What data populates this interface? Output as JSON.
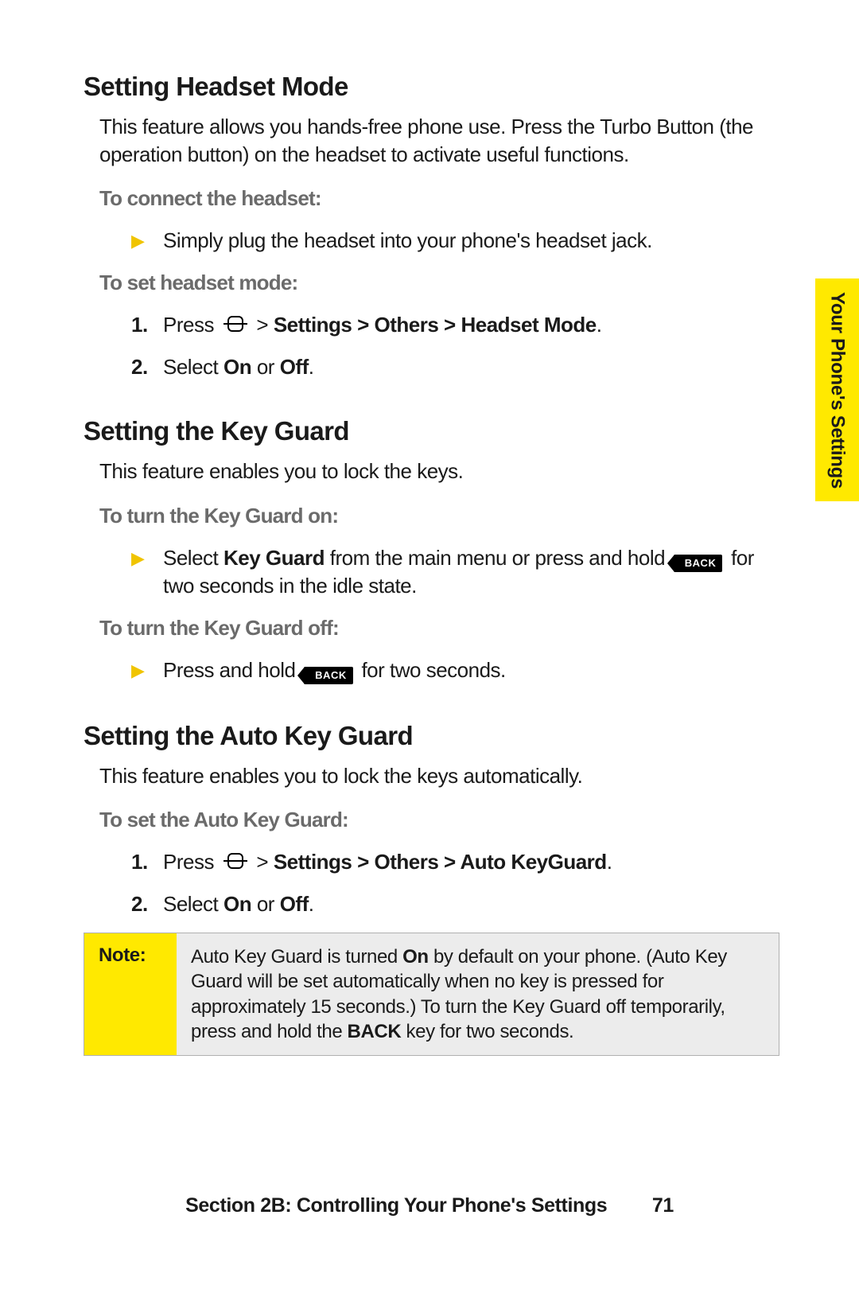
{
  "sidetab": "Your Phone's Settings",
  "sections": [
    {
      "title": "Setting Headset Mode",
      "intro": "This feature allows you hands-free phone use. Press the Turbo Button (the operation button) on the headset to activate useful functions.",
      "groups": [
        {
          "lead": "To connect the headset:",
          "items": [
            {
              "type": "bullet",
              "text": "Simply plug the headset into your phone's headset jack."
            }
          ]
        },
        {
          "lead": "To set headset mode:",
          "items": [
            {
              "type": "num",
              "n": "1.",
              "pre": "Press ",
              "icon": "menu",
              "post": " > ",
              "bold": "Settings > Others > Headset Mode",
              "tail": "."
            },
            {
              "type": "num",
              "n": "2.",
              "pre": "Select ",
              "bold": "On",
              "mid": " or ",
              "bold2": "Off",
              "tail": "."
            }
          ]
        }
      ]
    },
    {
      "title": "Setting the Key Guard",
      "intro": "This feature enables you to lock the keys.",
      "groups": [
        {
          "lead": "To turn the Key Guard on:",
          "items": [
            {
              "type": "bullet",
              "pre": "Select ",
              "bold": "Key Guard",
              "mid": " from the main menu or press and hold ",
              "back": true,
              "tail": " for two seconds in the idle state."
            }
          ]
        },
        {
          "lead": "To turn the Key Guard off:",
          "items": [
            {
              "type": "bullet",
              "pre": "Press and hold ",
              "back": true,
              "tail": " for two seconds."
            }
          ]
        }
      ]
    },
    {
      "title": "Setting the Auto Key Guard",
      "intro": "This feature enables you to lock the keys automatically.",
      "groups": [
        {
          "lead": "To set the Auto Key Guard:",
          "items": [
            {
              "type": "num",
              "n": "1.",
              "pre": "Press ",
              "icon": "menu",
              "post": " > ",
              "bold": "Settings > Others > Auto KeyGuard",
              "tail": "."
            },
            {
              "type": "num",
              "n": "2.",
              "pre": "Select ",
              "bold": "On",
              "mid": " or ",
              "bold2": "Off",
              "tail": "."
            }
          ]
        }
      ]
    }
  ],
  "note": {
    "label": "Note:",
    "body_pre": "Auto Key Guard is turned ",
    "body_bold1": "On",
    "body_mid": " by default on your phone. (Auto Key Guard will be set automatically when no key is pressed for approximately 15 seconds.) To turn the Key Guard off temporarily, press and hold the ",
    "body_bold2": "BACK",
    "body_tail": " key for two seconds."
  },
  "footer": {
    "section": "Section 2B: Controlling Your Phone's Settings",
    "page": "71"
  },
  "back_key_text": "BACK"
}
